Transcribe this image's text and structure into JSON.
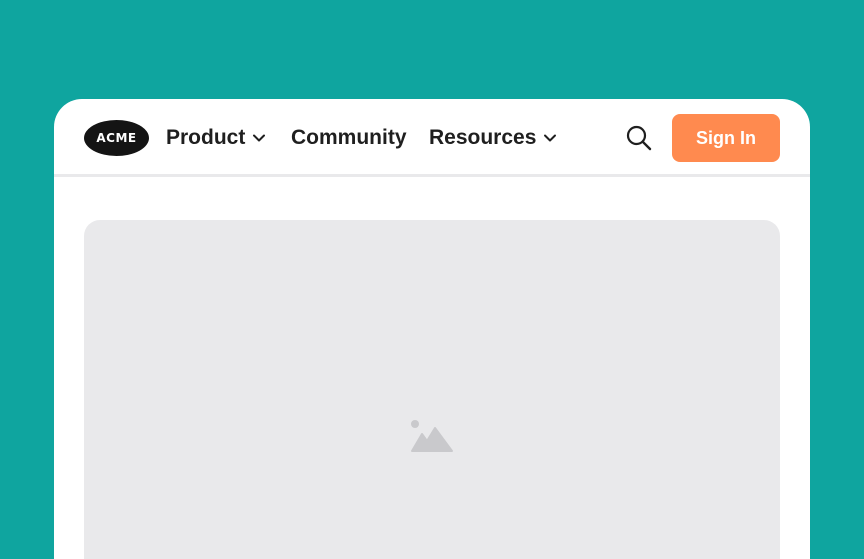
{
  "logo": {
    "text": "ACME",
    "colors": {
      "fill": "#141414",
      "text": "#FFFFFF"
    }
  },
  "nav": {
    "items": [
      {
        "label": "Product",
        "has_dropdown": true,
        "icon": "chevron-down-icon"
      },
      {
        "label": "Community",
        "has_dropdown": false
      },
      {
        "label": "Resources",
        "has_dropdown": true,
        "icon": "chevron-down-icon"
      }
    ]
  },
  "header": {
    "search_icon": "search-icon",
    "signin_label": "Sign In"
  },
  "hero": {
    "icon": "image-placeholder-icon"
  },
  "colors": {
    "background": "#0FA59F",
    "card": "#FFFFFF",
    "accent": "#FF8A4F",
    "text": "#1F1F1F",
    "placeholder": "#E9E9EB",
    "placeholder_icon": "#C9C9CC",
    "divider": "#E9E9EB"
  }
}
